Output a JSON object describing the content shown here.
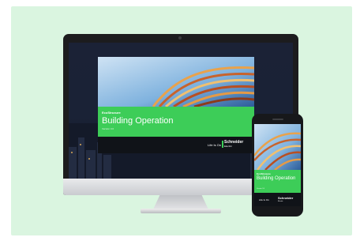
{
  "slide": {
    "logo_text": "EcoStruxure",
    "title": "Building Operation",
    "subtitle": "Version 3.0",
    "tagline": "Life Is On",
    "brand_name": "Schneider",
    "brand_sub": "Electric"
  },
  "colors": {
    "background": "#daf5e0",
    "brand_green": "#3dcd58",
    "device_dark": "#1c1c1e"
  }
}
